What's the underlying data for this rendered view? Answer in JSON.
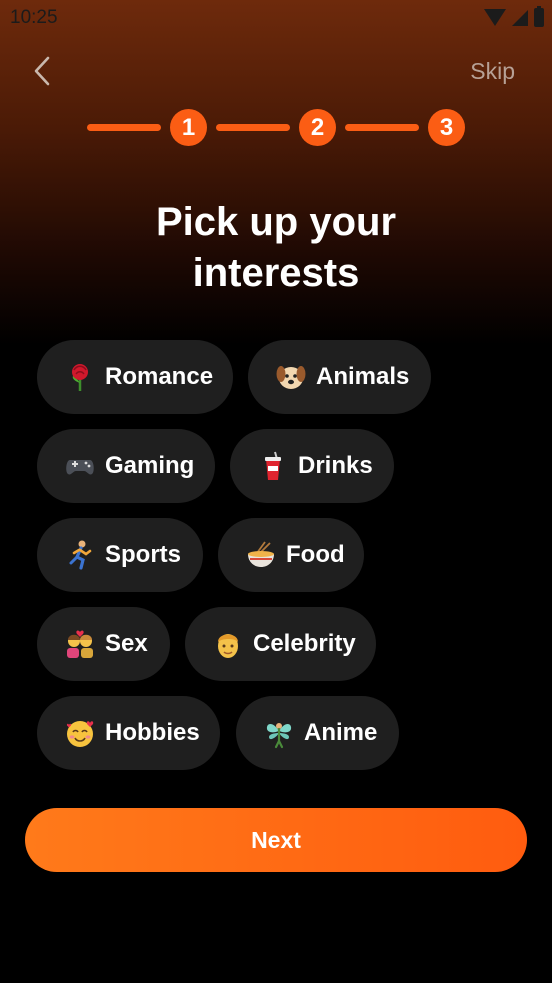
{
  "status_bar": {
    "time": "10:25",
    "icons": [
      "wifi-icon",
      "signal-icon",
      "battery-icon"
    ]
  },
  "header": {
    "back_icon": "chevron-left-icon",
    "skip_label": "Skip"
  },
  "stepper": {
    "steps": [
      "1",
      "2",
      "3"
    ],
    "accent_color": "#fb5d14"
  },
  "title": {
    "line1": "Pick up your",
    "line2": "interests"
  },
  "interests": [
    {
      "label": "Romance",
      "icon": "rose-icon"
    },
    {
      "label": "Animals",
      "icon": "dog-icon"
    },
    {
      "label": "Gaming",
      "icon": "gamepad-icon"
    },
    {
      "label": "Drinks",
      "icon": "drink-cup-icon"
    },
    {
      "label": "Sports",
      "icon": "runner-icon"
    },
    {
      "label": "Food",
      "icon": "noodle-bowl-icon"
    },
    {
      "label": "Sex",
      "icon": "couple-icon"
    },
    {
      "label": "Celebrity",
      "icon": "person-icon"
    },
    {
      "label": "Hobbies",
      "icon": "smiling-hearts-icon"
    },
    {
      "label": "Anime",
      "icon": "fairy-icon"
    }
  ],
  "next_button": {
    "label": "Next",
    "color": "#ff6a14"
  }
}
